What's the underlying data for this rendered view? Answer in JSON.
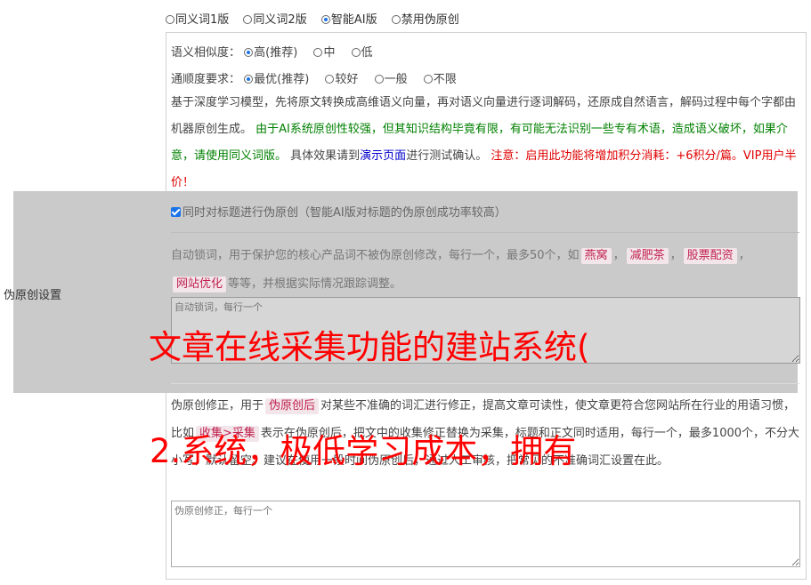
{
  "mode_options": [
    {
      "label": "同义词1版",
      "checked": false
    },
    {
      "label": "同义词2版",
      "checked": false
    },
    {
      "label": "智能AI版",
      "checked": true
    },
    {
      "label": "禁用伪原创",
      "checked": false
    }
  ],
  "similarity": {
    "label": "语义相似度：",
    "options": [
      {
        "label": "高(推荐)",
        "checked": true
      },
      {
        "label": "中",
        "checked": false
      },
      {
        "label": "低",
        "checked": false
      }
    ]
  },
  "fluency": {
    "label": "通顺度要求：",
    "options": [
      {
        "label": "最优(推荐)",
        "checked": true
      },
      {
        "label": "较好",
        "checked": false
      },
      {
        "label": "一般",
        "checked": false
      },
      {
        "label": "不限",
        "checked": false
      }
    ]
  },
  "description": {
    "part1": "基于深度学习模型，先将原文转换成高维语义向量，再对语义向量进行逐词解码，还原成自然语言，解码过程中每个字都由机器原创生成。",
    "part2_green": "由于AI系统原创性较强，但其知识结构毕竟有限，有可能无法识别一些专有术语，造成语义破坏，如果介意，请使用同义词版。",
    "part3": "具体效果请到",
    "link": "演示页面",
    "part4": "进行测试确认。",
    "part5_red": "注意：启用此功能将增加积分消耗：+6积分/篇。VIP用户半价！"
  },
  "side_label": "伪原创设置",
  "title_option": {
    "label": "同时对标题进行伪原创（智能AI版对标题的伪原创成功率较高）",
    "checked": true
  },
  "lock_words": {
    "desc_prefix": "自动锁词，用于保护您的核心产品词不被伪原创修改，每行一个，最多50个，如",
    "examples": [
      "燕窝",
      "减肥茶",
      "股票配资",
      "网站优化"
    ],
    "sep": "，",
    "desc_suffix": "等等，并根据实际情况跟踪调整。",
    "placeholder": "自动锁词，每行一个"
  },
  "fix_words": {
    "desc_prefix": "伪原创修正，用于",
    "tag1": "伪原创后",
    "desc_mid1": "对某些不准确的词汇进行修正，提高文章可读性，使文章更符合您网站所在行业的用语习惯，比如",
    "tag2": "收集>采集",
    "desc_mid2": "表示在伪原创后，把文中的收集修正替换为采集，标题和正文同时适用，每行一个，最多1000个，不分大小写，默认留空。建议在使用一段时间伪原创后，通过人工审核，把常见的不准确词汇设置在此。",
    "placeholder": "伪原创修正，每行一个"
  },
  "headline1": "文章在线采集功能的建站系统(",
  "headline2": "2.系统，极低学习成本，拥有"
}
